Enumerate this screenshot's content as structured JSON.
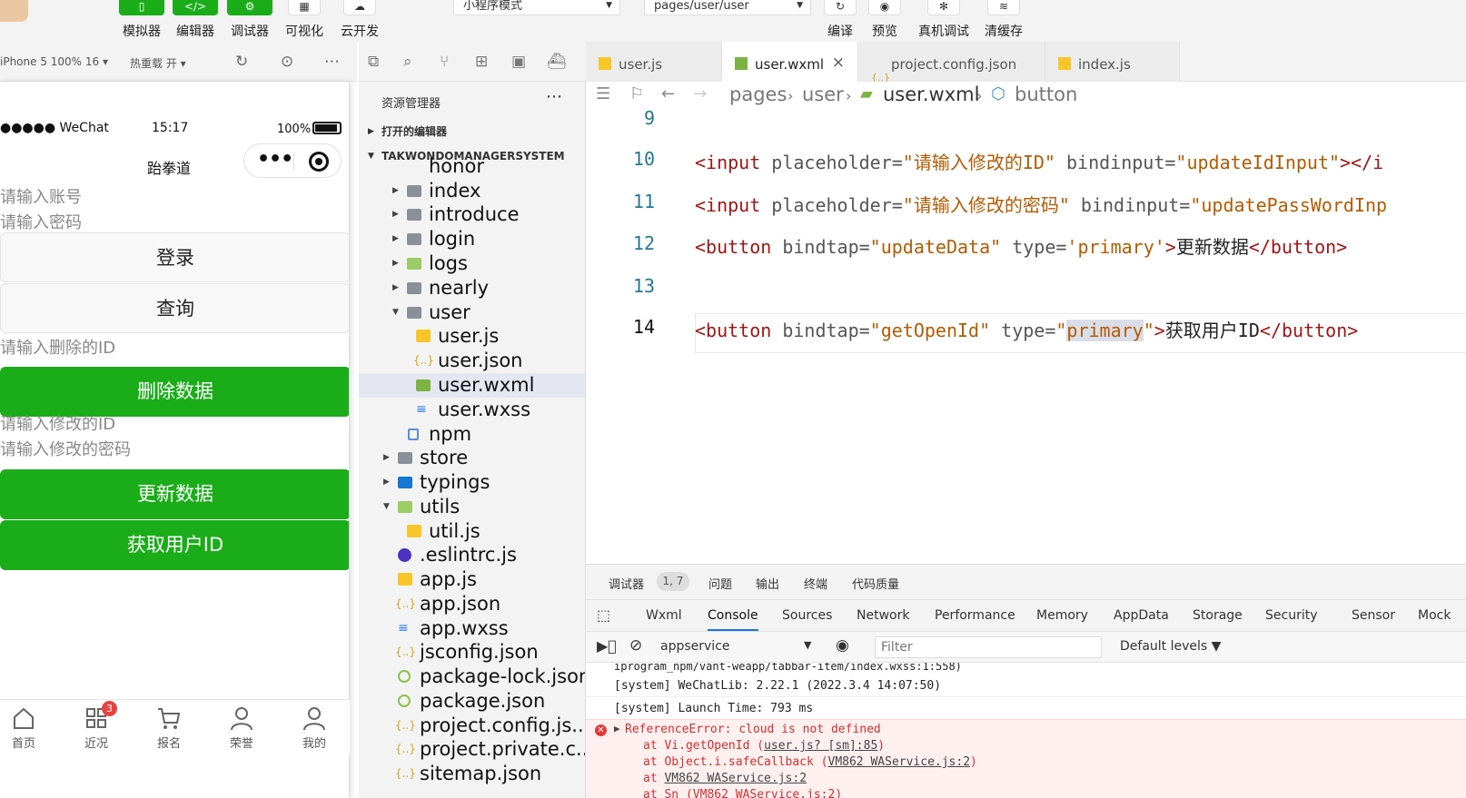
{
  "toolbar": {
    "buttons": [
      "模拟器",
      "编辑器",
      "调试器",
      "可视化",
      "云开发"
    ],
    "mode_select": "小程序模式",
    "page_select": "pages/user/user",
    "right_buttons": [
      "编译",
      "预览",
      "真机调试",
      "清缓存"
    ]
  },
  "simulator_bar": {
    "device": "iPhone 5 100% 16",
    "hot_reload": "热重载 开"
  },
  "phone": {
    "carrier": "●●●●● WeChat",
    "time": "15:17",
    "battery": "100%",
    "nav_title": "跆拳道",
    "account_placeholder": "请输入账号",
    "password_placeholder": "请输入密码",
    "login_button": "登录",
    "query_button": "查询",
    "delete_id_placeholder": "请输入删除的ID",
    "delete_button": "删除数据",
    "update_id_placeholder": "请输入修改的ID",
    "update_password_placeholder": "请输入修改的密码",
    "update_button": "更新数据",
    "openid_button": "获取用户ID",
    "tabs": [
      "首页",
      "近况",
      "报名",
      "荣誉",
      "我的"
    ],
    "badge": "3"
  },
  "explorer": {
    "title": "资源管理器",
    "open_editors": "打开的编辑器",
    "project": "TAKWONDOMANAGERSYSTEM",
    "items": [
      "honor",
      "index",
      "introduce",
      "login",
      "logs",
      "nearly",
      "user",
      "user.js",
      "user.json",
      "user.wxml",
      "user.wxss",
      "npm",
      "store",
      "typings",
      "utils",
      "util.js",
      ".eslintrc.js",
      "app.js",
      "app.json",
      "app.wxss",
      "jsconfig.json",
      "package-lock.json",
      "package.json",
      "project.config.js...",
      "project.private.c...",
      "sitemap.json"
    ]
  },
  "editor": {
    "tabs": [
      "user.js",
      "user.wxml",
      "project.config.json",
      "index.js"
    ],
    "breadcrumb": [
      "pages",
      "user",
      "user.wxml",
      "button"
    ],
    "line_numbers": [
      "9",
      "10",
      "11",
      "12",
      "13",
      "14"
    ],
    "lines": {
      "l10": [
        "<input",
        " placeholder=",
        "\"请输入修改的ID\"",
        " bindinput=",
        "\"updateIdInput\"",
        "></i"
      ],
      "l11": [
        "<input",
        " placeholder=",
        "\"请输入修改的密码\"",
        " bindinput=",
        "\"updatePassWordInp"
      ],
      "l12": [
        "<button",
        " bindtap=",
        "\"updateData\"",
        " type=",
        "'primary'",
        ">",
        "更新数据",
        "</button>"
      ],
      "l14": [
        "<button",
        " bindtap=",
        "\"getOpenId\"",
        " type=",
        "\"",
        "primary",
        "\"",
        ">",
        "获取用户ID",
        "</button>"
      ]
    }
  },
  "devtools": {
    "panel_tabs": [
      "调试器",
      "问题",
      "输出",
      "终端",
      "代码质量"
    ],
    "panel_badge": "1, 7",
    "tabs": [
      "Wxml",
      "Console",
      "Sources",
      "Network",
      "Performance",
      "Memory",
      "AppData",
      "Storage",
      "Security",
      "Sensor",
      "Mock"
    ],
    "context": "appservice",
    "filter_placeholder": "Filter",
    "levels": "Default levels ▼",
    "console": {
      "truncated": "iprogram_npm/vant-weapp/tabbar-item/index.wxss:1:558)",
      "sys1": "[system] WeChatLib: 2.22.1 (2022.3.4 14:07:50)",
      "sys2": "[system] Launch Time: 793 ms",
      "error": "ReferenceError: cloud is not defined",
      "trace1_pre": "at Vi.getOpenId (",
      "trace1_link": "user.js? [sm]:85",
      "trace2_pre": "at Object.i.safeCallback (",
      "trace2_link": "VM862 WAService.js:2",
      "trace3_pre": "at ",
      "trace3_link": "VM862 WAService.js:2",
      "trace4": "at Sn (VM862 WAService.js:2)"
    }
  },
  "colors": {
    "wechat_green": "#1aad19",
    "tag": "#a31515",
    "string": "#b55a00",
    "line_number": "#237893",
    "error": "#d32f2f"
  }
}
